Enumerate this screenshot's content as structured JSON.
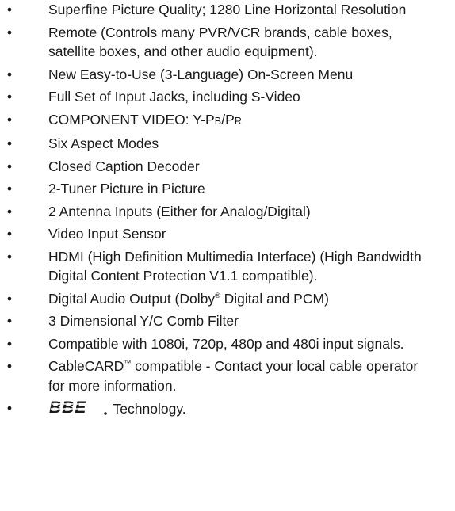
{
  "bullet": "•",
  "features": [
    {
      "text": "Superfine Picture Quality; 1280 Line Horizontal Resolution"
    },
    {
      "text": "Remote (Controls many PVR/VCR brands, cable boxes, satellite boxes, and other audio equipment)."
    },
    {
      "text": "New Easy-to-Use (3-Language) On-Screen Menu"
    },
    {
      "text": "Full Set of Input Jacks, including S-Video"
    },
    {
      "prefix": "COMPONENT VIDEO: Y-P",
      "sub1": "B",
      "mid": "/P",
      "sub2": "R"
    },
    {
      "text": "Six Aspect Modes"
    },
    {
      "text": "Closed Caption Decoder"
    },
    {
      "text": "2-Tuner Picture in Picture"
    },
    {
      "text": "2 Antenna Inputs (Either for Analog/Digital)"
    },
    {
      "text": "Video Input Sensor"
    },
    {
      "text": "HDMI (High Definition Multimedia Interface) (High Bandwidth Digital Content Protection V1.1 compatible)."
    },
    {
      "before": "Digital Audio Output (Dolby",
      "mark": "®",
      "after": " Digital and PCM)"
    },
    {
      "text": "3 Dimensional Y/C Comb Filter"
    },
    {
      "text": "Compatible with 1080i, 720p, 480p and 480i input signals."
    },
    {
      "before": "CableCARD",
      "mark": "™",
      "after": " compatible - Contact your local cable operator for more information."
    },
    {
      "logo_text": "BBE",
      "after": " Technology."
    }
  ]
}
